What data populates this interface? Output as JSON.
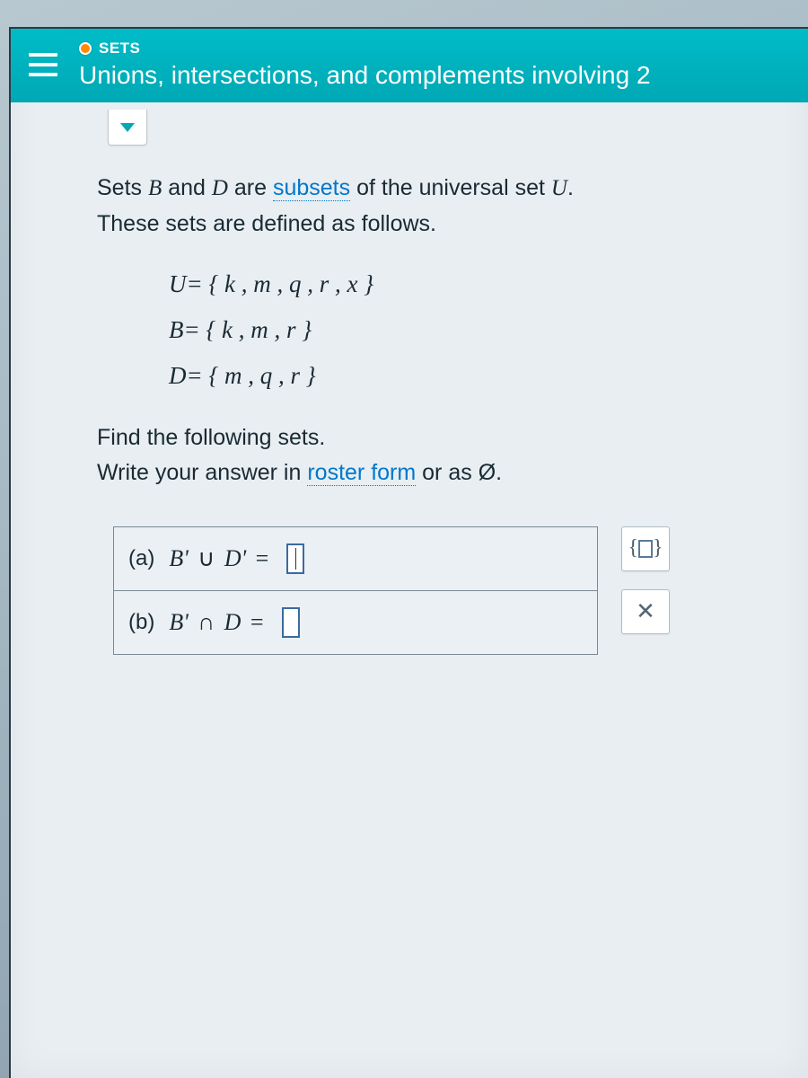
{
  "header": {
    "category": "SETS",
    "topic": "Unions, intersections, and complements involving 2"
  },
  "intro": {
    "pre": "Sets ",
    "setB": "B",
    "mid1": " and ",
    "setD": "D",
    "mid2": " are ",
    "link": "subsets",
    "mid3": " of the universal set ",
    "setU": "U",
    "post": ".",
    "line2": "These sets are defined as follows."
  },
  "defs": {
    "U": "U= { k , m , q , r , x }",
    "B": "B= { k , m , r }",
    "D": "D= { m , q , r }"
  },
  "instruct": {
    "line1": "Find the following sets.",
    "pre": "Write your answer in ",
    "link": "roster form",
    "mid": " or as ",
    "empty": "Ø",
    "post": "."
  },
  "answers": {
    "a": {
      "label": "(a)",
      "lhs_B": "B'",
      "op": "∪",
      "lhs_D": "D'",
      "eq": "="
    },
    "b": {
      "label": "(b)",
      "lhs_B": "B'",
      "op": "∩",
      "lhs_D": "D",
      "eq": "="
    }
  },
  "tools": {
    "set_open": "{",
    "set_close": "}",
    "clear": "✕"
  }
}
